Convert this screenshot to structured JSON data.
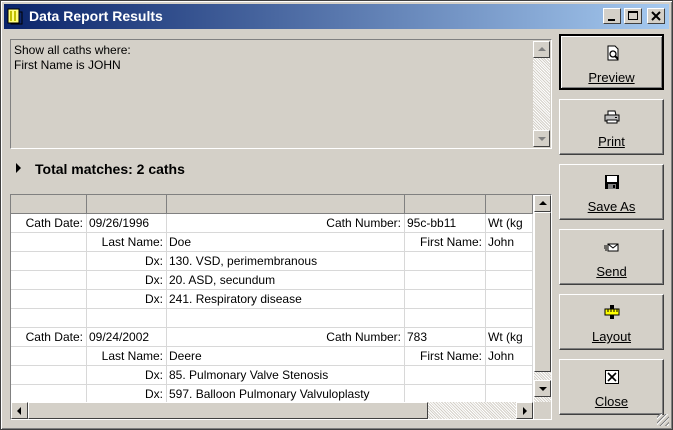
{
  "window": {
    "title": "Data Report Results"
  },
  "criteria": {
    "text": "Show all caths where:\nFirst Name is JOHN"
  },
  "summary": {
    "total": "Total matches: 2 caths"
  },
  "grid": {
    "records": [
      {
        "rows": [
          [
            "Cath Date:",
            "09/26/1996",
            "Cath Number:",
            "95c-bb11",
            "Wt (kg"
          ],
          [
            "",
            "Last Name:",
            "Doe",
            "First Name:",
            "John"
          ],
          [
            "",
            "Dx:",
            "130. VSD, perimembranous",
            "",
            ""
          ],
          [
            "",
            "Dx:",
            "20. ASD, secundum",
            "",
            ""
          ],
          [
            "",
            "Dx:",
            "241. Respiratory disease",
            "",
            ""
          ],
          [
            "",
            "",
            "",
            "",
            ""
          ]
        ]
      },
      {
        "rows": [
          [
            "Cath Date:",
            "09/24/2002",
            "Cath Number:",
            "783",
            "Wt (kg"
          ],
          [
            "",
            "Last Name:",
            "Deere",
            "First Name:",
            "John"
          ],
          [
            "",
            "Dx:",
            "85. Pulmonary Valve Stenosis",
            "",
            ""
          ],
          [
            "",
            "Dx:",
            "597. Balloon Pulmonary Valvuloplasty",
            "",
            ""
          ]
        ]
      }
    ]
  },
  "buttons": {
    "preview": "Preview",
    "print": "Print",
    "save_as": "Save As",
    "send": "Send",
    "layout": "Layout",
    "close": "Close"
  },
  "icons": {
    "app": "report-icon",
    "preview": "magnifier-page-icon",
    "print": "printer-icon",
    "save": "floppy-disk-icon",
    "send": "send-icon",
    "layout": "ruler-icon",
    "close": "close-box-icon"
  }
}
